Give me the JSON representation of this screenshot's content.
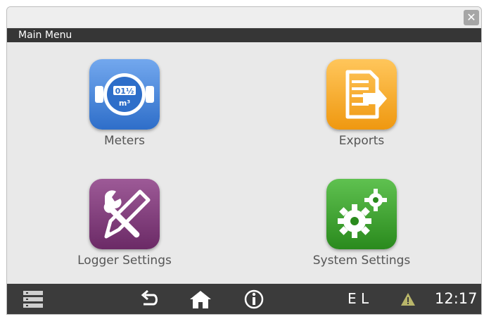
{
  "window": {
    "close_glyph": "✕"
  },
  "menubar": {
    "title": "Main Menu"
  },
  "tiles": [
    {
      "label": "Meters",
      "icon": "meter-icon",
      "color": "#2e6ec9"
    },
    {
      "label": "Exports",
      "icon": "export-document-icon",
      "color": "#ef9810"
    },
    {
      "label": "Logger Settings",
      "icon": "tools-icon",
      "color": "#6b2a66"
    },
    {
      "label": "System Settings",
      "icon": "gears-icon",
      "color": "#2a8a1d"
    }
  ],
  "meter_icon": {
    "digits": "01½",
    "unit": "m³"
  },
  "bottombar": {
    "status_letters": "E L",
    "time": "12:17",
    "icons": [
      "list-menu-icon",
      "back-icon",
      "home-icon",
      "info-icon",
      "warning-icon"
    ]
  }
}
